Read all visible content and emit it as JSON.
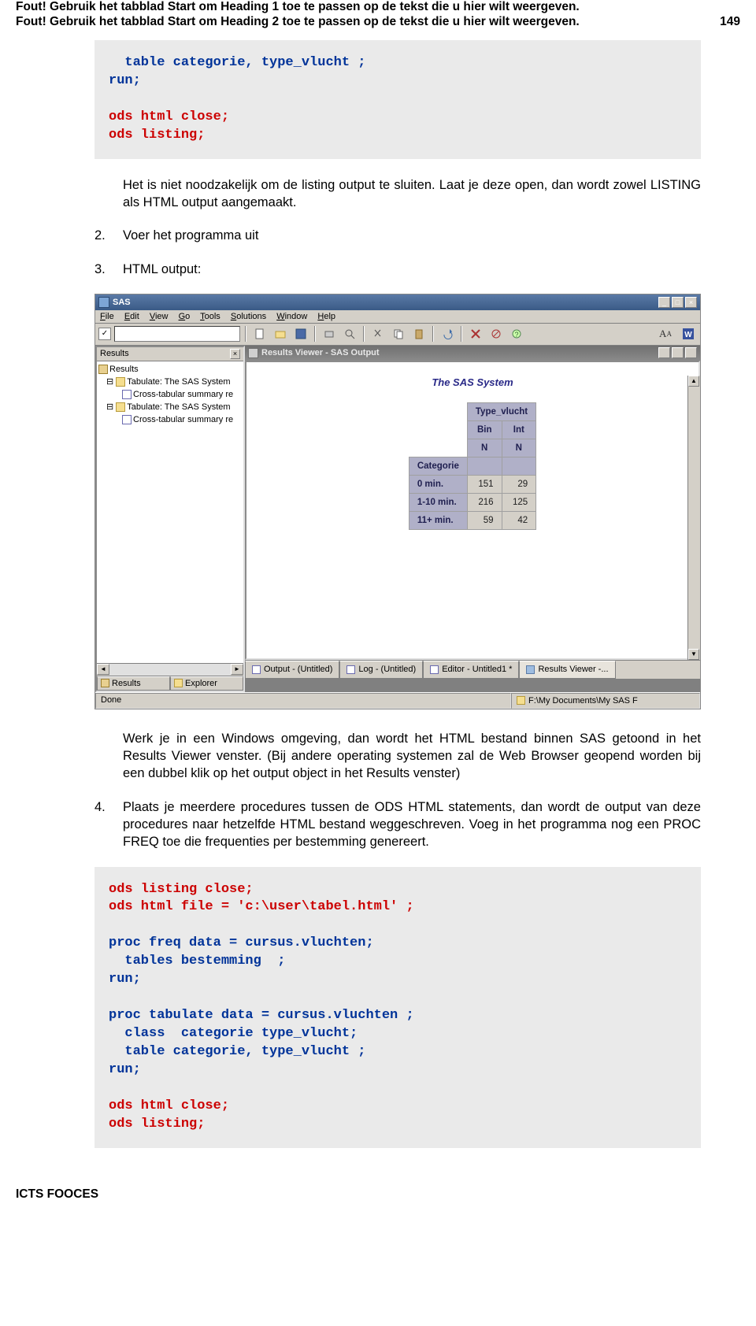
{
  "header": {
    "line1": "Fout! Gebruik het tabblad Start om Heading 1 toe te passen op de tekst die u hier wilt weergeven.",
    "line2": "Fout! Gebruik het tabblad Start om Heading 2 toe te passen op de tekst die u hier wilt weergeven.",
    "pagenum": "149"
  },
  "code1": {
    "l1": "  table categorie, type_vlucht ;",
    "l2": "run;",
    "l3": "ods html close;",
    "l4": "ods listing;"
  },
  "para1": "Het is niet noodzakelijk om de listing output te sluiten. Laat je deze open, dan wordt zowel LISTING als HTML output aangemaakt.",
  "items": {
    "n2": "2.",
    "t2": "Voer het programma uit",
    "n3": "3.",
    "t3": "HTML output:"
  },
  "sas": {
    "title": "SAS",
    "menu": {
      "file": "File",
      "edit": "Edit",
      "view": "View",
      "go": "Go",
      "tools": "Tools",
      "solutions": "Solutions",
      "window": "Window",
      "help": "Help"
    },
    "winbtns": {
      "min": "_",
      "max": "□",
      "close": "×"
    },
    "leftpane": {
      "title": "Results",
      "tree": {
        "root": "Results",
        "r1": "Tabulate: The SAS System",
        "r1a": "Cross-tabular summary re",
        "r2": "Tabulate: The SAS System",
        "r2a": "Cross-tabular summary re"
      },
      "tabs": {
        "results": "Results",
        "explorer": "Explorer"
      }
    },
    "inner": {
      "title": "Results Viewer - SAS Output",
      "rvtitle": "The SAS System",
      "table": {
        "tv": "Type_vlucht",
        "bin": "Bin",
        "int": "Int",
        "n1": "N",
        "n2": "N",
        "cat": "Categorie",
        "r1": {
          "l": "0 min.",
          "a": "151",
          "b": "29"
        },
        "r2": {
          "l": "1-10 min.",
          "a": "216",
          "b": "125"
        },
        "r3": {
          "l": "11+ min.",
          "a": "59",
          "b": "42"
        }
      }
    },
    "bottomtabs": {
      "output": "Output - (Untitled)",
      "log": "Log - (Untitled)",
      "editor": "Editor - Untitled1 *",
      "rv": "Results Viewer -..."
    },
    "status": {
      "left": "Done",
      "right": "F:\\My Documents\\My SAS F"
    }
  },
  "para3": "Werk je in een Windows omgeving, dan wordt het HTML bestand binnen SAS getoond in het Results Viewer venster. (Bij andere operating systemen zal de Web Browser geopend worden bij een dubbel klik op het output object in het Results venster)",
  "item4": {
    "n": "4.",
    "t": "Plaats je meerdere procedures tussen de ODS HTML statements, dan wordt de output van deze procedures naar hetzelfde HTML bestand weggeschreven. Voeg in het programma nog een PROC FREQ toe die frequenties per bestemming genereert."
  },
  "code2": {
    "l1": "ods listing close;",
    "l2": "ods html file = 'c:\\user\\tabel.html' ;",
    "l3": "proc freq data = cursus.vluchten;",
    "l4": "  tables bestemming  ;",
    "l5": "run;",
    "l6": "proc tabulate data = cursus.vluchten ;",
    "l7": "  class  categorie type_vlucht;",
    "l8": "  table categorie, type_vlucht ;",
    "l9": "run;",
    "l10": "ods html close;",
    "l11": "ods listing;"
  },
  "footer": "ICTS FOOCES"
}
